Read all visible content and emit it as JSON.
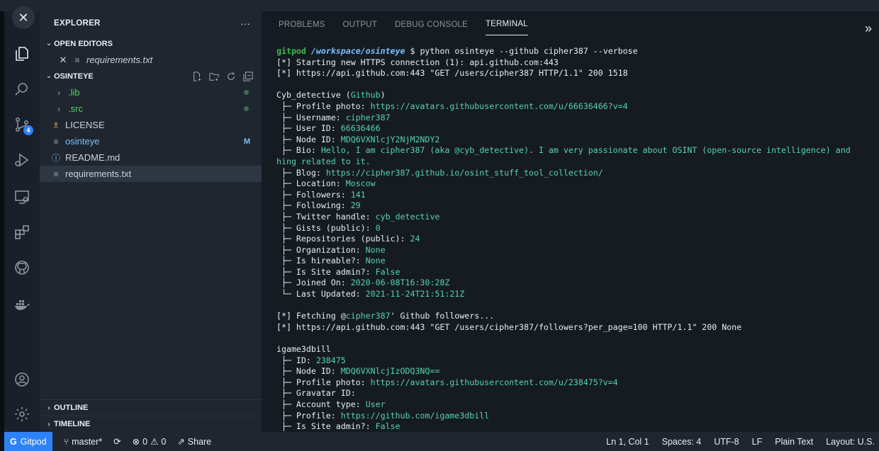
{
  "sidebar": {
    "title": "EXPLORER",
    "more": "···",
    "open_editors": {
      "label": "OPEN EDITORS",
      "files": [
        {
          "name": "requirements.txt"
        }
      ]
    },
    "workspace": {
      "label": "OSINTEYE",
      "files": [
        {
          "name": ".lib"
        },
        {
          "name": ".src"
        },
        {
          "name": "LICENSE"
        },
        {
          "name": "osinteye",
          "status": "M"
        },
        {
          "name": "README.md"
        },
        {
          "name": "requirements.txt"
        }
      ]
    },
    "outline": "OUTLINE",
    "timeline": "TIMELINE"
  },
  "activity_bar": {
    "scm_badge": "4"
  },
  "panel": {
    "tabs": [
      "PROBLEMS",
      "OUTPUT",
      "DEBUG CONSOLE",
      "TERMINAL"
    ],
    "active_tab": "TERMINAL"
  },
  "terminal": {
    "prompt_user": "gitpod",
    "prompt_path": "/workspace/osinteye",
    "prompt_symbol": "$",
    "command": "python osinteye --github cipher387 --verbose",
    "lines": {
      "l1": "[*] Starting new HTTPS connection (1): api.github.com:443",
      "l2": "[*] https://api.github.com:443 \"GET /users/cipher387 HTTP/1.1\" 200 1518",
      "user_header_name": "Cyb_detective",
      "user_header_src": "Github",
      "profile_photo": "https://avatars.githubusercontent.com/u/66636466?v=4",
      "username": "cipher387",
      "user_id": "66636466",
      "node_id": "MDQ6VXNlcjY2NjM2NDY2",
      "bio": "Hello, I am cipher387 (aka @cyb_detective). I am very passionate about OSINT (open-source intelligence) and",
      "bio_wrap": "hing related to it.",
      "blog": "https://cipher387.github.io/osint_stuff_tool_collection/",
      "location": "Moscow",
      "followers": "141",
      "following": "29",
      "twitter": "cyb_detective",
      "gists": "0",
      "repos": "24",
      "organization": "None",
      "hireable": "None",
      "site_admin": "False",
      "joined": "2020-06-08T16:30:28Z",
      "updated": "2021-11-24T21:51:21Z",
      "fetch1_pre": "[*] Fetching @",
      "fetch1_user": "cipher387",
      "fetch1_post": "' Github followers...",
      "fetch2": "[*] https://api.github.com:443 \"GET /users/cipher387/followers?per_page=100 HTTP/1.1\" 200 None",
      "f_header": "igame3dbill",
      "f_id": "238475",
      "f_node": "MDQ6VXNlcjIzODQ3NQ==",
      "f_photo": "https://avatars.githubusercontent.com/u/238475?v=4",
      "f_gravatar": "",
      "f_type": "User",
      "f_profile": "https://github.com/igame3dbill",
      "f_admin": "False"
    }
  },
  "status_bar": {
    "remote": "Gitpod",
    "branch": "master*",
    "errors": "0",
    "warnings": "0",
    "share": "Share",
    "position": "Ln 1, Col 1",
    "spaces": "Spaces: 4",
    "encoding": "UTF-8",
    "eol": "LF",
    "language": "Plain Text",
    "layout": "Layout: U.S."
  }
}
